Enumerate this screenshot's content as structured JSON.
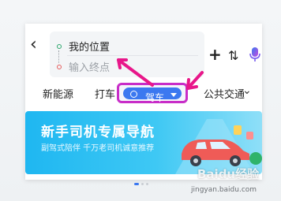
{
  "header": {
    "back_icon": "chevron-left-icon",
    "start_field": "我的位置",
    "end_placeholder": "输入终点"
  },
  "tools": {
    "add_icon": "plus-icon",
    "swap_icon": "swap-icon",
    "mic_icon": "mic-icon"
  },
  "tabs": {
    "items": [
      "新能源",
      "打车",
      "驾车",
      "公共交通"
    ],
    "active": "驾车",
    "more_icon": "chevron-down-icon"
  },
  "banner": {
    "title": "新手司机专属导航",
    "subtitle": "副驾式陪伴  千万老司机诚意推荐"
  },
  "watermark": {
    "brand": "Baidu经验",
    "url": "jingyan.baidu.com"
  },
  "colors": {
    "accent": "#3b78f0",
    "highlight": "#c82dc8",
    "annotation": "#e8178a",
    "banner": "#1fb7f1"
  }
}
